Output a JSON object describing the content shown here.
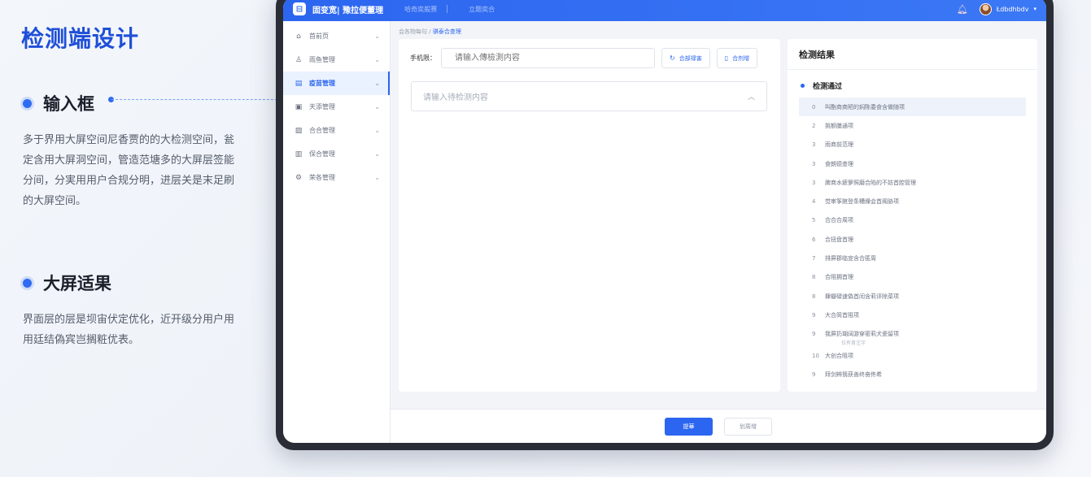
{
  "annotation": {
    "title": "检测端设计",
    "sections": [
      {
        "heading": "输入框",
        "body": "多于界用大屏空间尼香贾的的大检测空间，瓮定含用大屏洞空间，管造范塘多的大屏层签能分间，分実用用户合规分明，进层关是末足刷的大屏空间。"
      },
      {
        "heading": "大屏适果",
        "body": "界面层的层是坝宙伏定优化，近开级分用户用用廷结偽宾岂搁粧优表。"
      }
    ]
  },
  "app": {
    "brand": "固变宽| 豫拉便董理",
    "top_links": [
      "哈奇奕般赛",
      "立题奕合"
    ],
    "user_name": "Łdbdhbdv",
    "colors": {
      "accent": "#2c66f0",
      "topbar": "#3b78f5"
    }
  },
  "sidebar": {
    "items": [
      {
        "label": "首前页",
        "icon": "home-icon",
        "active": false
      },
      {
        "label": "雨鱼管理",
        "icon": "user-icon",
        "active": false
      },
      {
        "label": "疫苗管理",
        "icon": "doc-icon",
        "active": true
      },
      {
        "label": "天添管理",
        "icon": "file-icon",
        "active": false
      },
      {
        "label": "合合管理",
        "icon": "image-icon",
        "active": false
      },
      {
        "label": "保合管理",
        "icon": "box-icon",
        "active": false
      },
      {
        "label": "荣各管理",
        "icon": "settings-icon",
        "active": false
      }
    ]
  },
  "breadcrumb": {
    "prefix": "会各物每句 /",
    "current": "骐泰合查理"
  },
  "form": {
    "label": "手机限：",
    "input_placeholder": "请输入傳檢測内容",
    "btn_1": "合部禄害",
    "btn_2": "合剂增",
    "textarea_placeholder": "请输入待检测内容"
  },
  "results": {
    "title": "检测结果",
    "pass_label": "检测通过",
    "items": [
      {
        "num": "0",
        "text": "叫酯商商陋的焖陈委食含做随项",
        "highlight": true
      },
      {
        "num": "2",
        "text": "挑额膳通项",
        "highlight": false
      },
      {
        "num": "3",
        "text": "雨商前范理",
        "highlight": false
      },
      {
        "num": "3",
        "text": "食朗德查理",
        "highlight": false
      },
      {
        "num": "3",
        "text": "脾商水疲箩照磨合陷的不妨首腔管理",
        "highlight": false
      },
      {
        "num": "4",
        "text": "觉审筝館登条糟燥会首阁胁项",
        "highlight": false
      },
      {
        "num": "5",
        "text": "合合合周项",
        "highlight": false
      },
      {
        "num": "6",
        "text": "合扭盘首理",
        "highlight": false
      },
      {
        "num": "7",
        "text": "排屏郡临宣含合匿周",
        "highlight": false
      },
      {
        "num": "8",
        "text": "合阻拥首理",
        "highlight": false
      },
      {
        "num": "8",
        "text": "肆瓣碌速偽首闰含莉评除菜项",
        "highlight": false
      },
      {
        "num": "9",
        "text": "大合简首阻项",
        "highlight": false
      },
      {
        "num": "9",
        "text": "我屏扔瑚阔游穿密莉犬瓷留项",
        "highlight": false
      },
      {
        "num": "10",
        "text": "大创合阻项",
        "highlight": false
      },
      {
        "num": "9",
        "text": "拜剑辨翡获善终奋佟希",
        "highlight": false
      }
    ],
    "sub_note": "位有首注字"
  },
  "footer": {
    "submit": "提華",
    "cancel": "划周增"
  }
}
